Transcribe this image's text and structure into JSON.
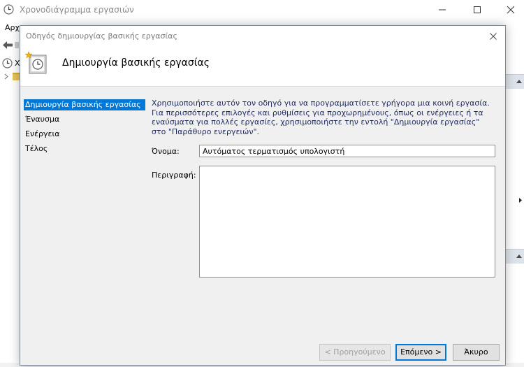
{
  "main_window": {
    "title": "Χρονοδιάγραμμα εργασιών",
    "menu_first_fragment": "Αρχ",
    "tree_root_fragment": "Χ"
  },
  "wizard": {
    "title": "Οδηγός δημιουργίας βασικής εργασίας",
    "heading": "Δημιουργία βασικής εργασίας",
    "steps": [
      {
        "label": "Δημιουργία βασικής εργασίας",
        "active": true
      },
      {
        "label": "Έναυσμα",
        "active": false
      },
      {
        "label": "Ενέργεια",
        "active": false
      },
      {
        "label": "Τέλος",
        "active": false
      }
    ],
    "description": "Χρησιμοποιήστε αυτόν τον οδηγό για να προγραμματίσετε γρήγορα μια κοινή εργασία. Για περισσότερες επιλογές και ρυθμίσεις για προχωρημένους, όπως οι ενέργειες ή τα εναύσματα για πολλές εργασίες, χρησιμοποιήστε την εντολή \"Δημιουργία εργασίας\" στο \"Παράθυρο ενεργειών\".",
    "name_label": "Όνομα:",
    "name_value": "Αυτόματος τερματισμός υπολογιστή",
    "description_label": "Περιγραφή:",
    "description_value": "",
    "buttons": {
      "back": "< Προηγούμενο",
      "next": "Επόμενο >",
      "cancel": "Άκυρο"
    }
  },
  "icons": [
    "clock-icon",
    "minimize-icon",
    "maximize-icon",
    "close-icon",
    "back-arrow-icon",
    "chevron-right-icon",
    "folder-icon",
    "chevron-up-icon",
    "triangle-right-icon",
    "task-wizard-icon"
  ],
  "colors": {
    "selection": "#0078d7",
    "dialog_bg": "#f0f0f0",
    "description_text": "#1e2a5e",
    "actions_header": "#dde3ea"
  }
}
